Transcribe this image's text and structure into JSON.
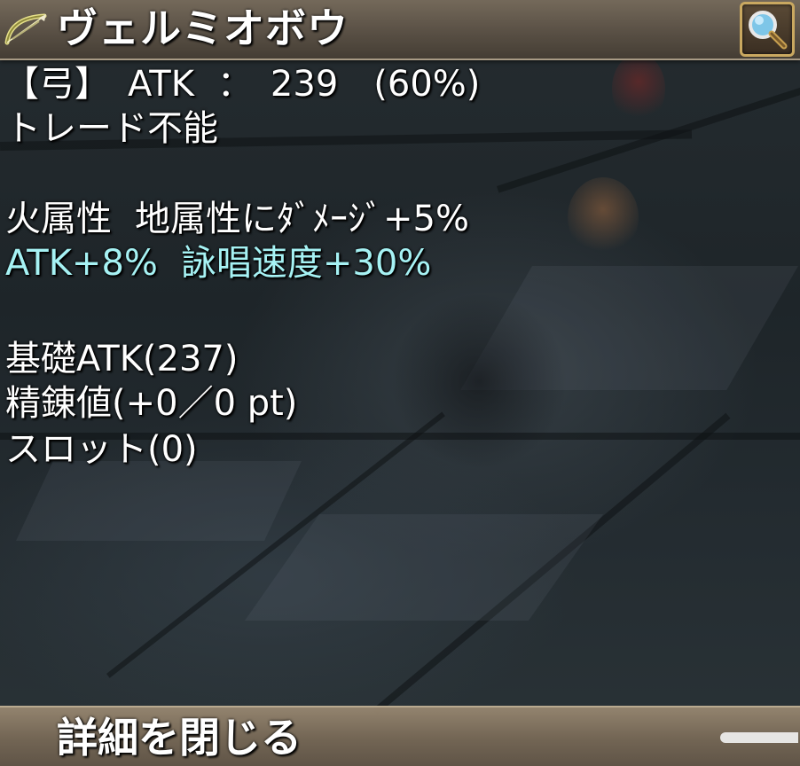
{
  "item": {
    "name": "ヴェルミオボウ",
    "icon": "bow-icon"
  },
  "header": {
    "magnify_icon": "magnifying-glass-icon"
  },
  "stats": {
    "type_label": "【弓】",
    "atk_label": "ATK",
    "atk_separator": "：",
    "atk_value": "239",
    "atk_percent": "(60%)",
    "trade": "トレード不能",
    "element": "火属性",
    "element_bonus": "地属性にﾀﾞﾒｰｼﾞ+5%",
    "bonus_atk": "ATK+8%",
    "bonus_cast": "詠唱速度+30%",
    "base_atk": "基礎ATK(237)",
    "refine": "精錬値(+0／0 pt)",
    "slot": "スロット(0)"
  },
  "footer": {
    "close_label": "詳細を閉じる"
  },
  "colors": {
    "text": "#ffffff",
    "bonus_text": "#a6f2f4",
    "bar": "#7a6c5a",
    "frame_gold": "#c9a860"
  }
}
